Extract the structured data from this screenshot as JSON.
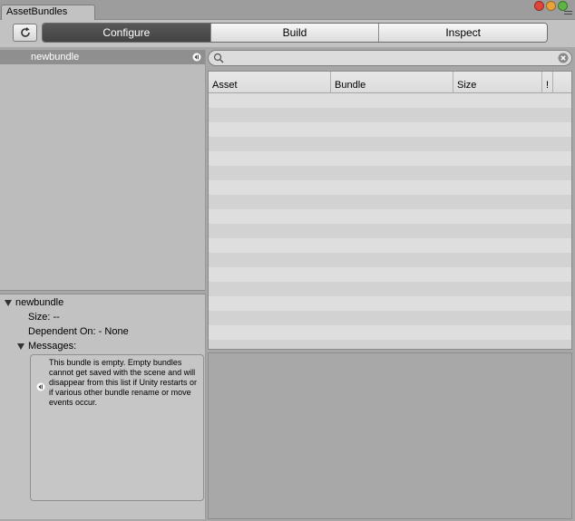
{
  "window": {
    "tab_title": "AssetBundles",
    "traffic_colors": [
      "#e0453b",
      "#e9a23a",
      "#5bb444"
    ]
  },
  "toolbar": {
    "refresh_icon": "refresh-icon",
    "tabs": [
      {
        "label": "Configure",
        "active": true
      },
      {
        "label": "Build",
        "active": false
      },
      {
        "label": "Inspect",
        "active": false
      }
    ]
  },
  "bundle_list": {
    "items": [
      {
        "name": "newbundle",
        "selected": true,
        "icon": "warning-icon"
      }
    ]
  },
  "details": {
    "title": "newbundle",
    "size": "Size: --",
    "dependent": "Dependent On: - None",
    "messages_label": "Messages:",
    "message": "This bundle is empty.  Empty bundles cannot get saved with the scene and will disappear from this list if Unity restarts or if various other bundle rename or move events occur."
  },
  "search": {
    "value": "",
    "placeholder": ""
  },
  "table": {
    "columns": [
      "Asset",
      "Bundle",
      "Size",
      "!"
    ],
    "rows": []
  }
}
